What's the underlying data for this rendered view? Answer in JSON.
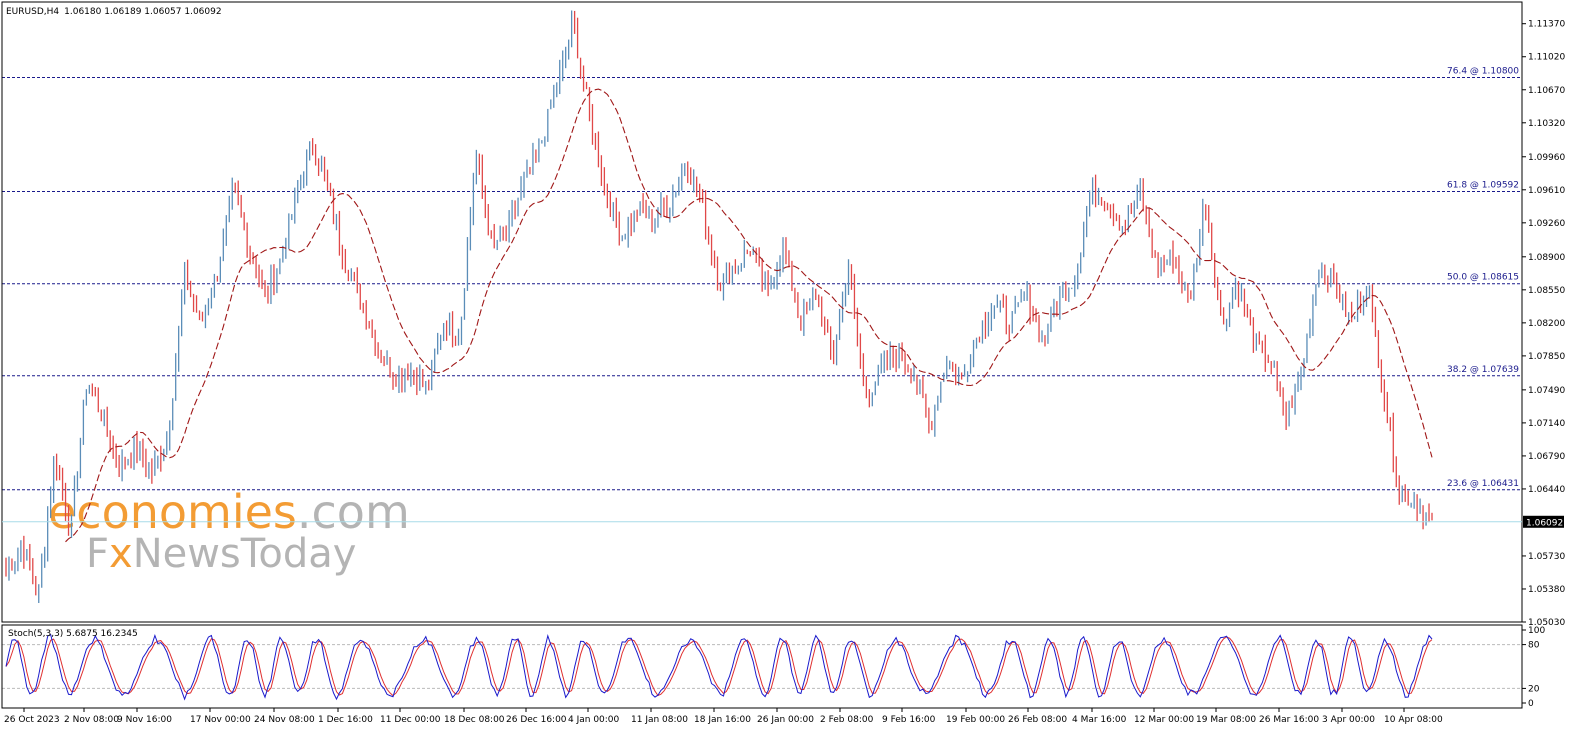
{
  "header": {
    "symbol": "EURUSD,H4",
    "ohlc": "1.06180 1.06189 1.06057 1.06092"
  },
  "watermark": {
    "line1_left": "economies",
    "line1_right": ".com",
    "line2_fx": "F",
    "line2_x": "x",
    "line2_rest": "NewsToday"
  },
  "colors": {
    "bull": "#5b8db8",
    "bear": "#e04848",
    "ma": "#a01818",
    "fib": "#1a1a8c",
    "current_price_line": "#a8dce8",
    "stoch_main": "#1a1acc",
    "stoch_signal": "#e03030",
    "watermark_orange": "#f39c34",
    "watermark_gray": "#b4b4b4"
  },
  "chart_data": {
    "type": "candlestick",
    "instrument": "EURUSD",
    "timeframe": "H4",
    "ylim": [
      1.0503,
      1.116
    ],
    "y_ticks": [
      "1.11370",
      "1.11020",
      "1.10670",
      "1.10320",
      "1.09960",
      "1.09610",
      "1.09260",
      "1.08900",
      "1.08550",
      "1.08200",
      "1.07850",
      "1.07490",
      "1.07140",
      "1.06790",
      "1.06440",
      "1.05730",
      "1.05380",
      "1.05030"
    ],
    "x_ticks": [
      "26 Oct 2023",
      "2 Nov 08:00",
      "9 Nov 16:00",
      "17 Nov 00:00",
      "24 Nov 08:00",
      "1 Dec 16:00",
      "11 Dec 00:00",
      "18 Dec 08:00",
      "26 Dec 16:00",
      "4 Jan 00:00",
      "11 Jan 08:00",
      "18 Jan 16:00",
      "26 Jan 00:00",
      "2 Feb 08:00",
      "9 Feb 16:00",
      "19 Feb 00:00",
      "26 Feb 08:00",
      "4 Mar 16:00",
      "12 Mar 00:00",
      "19 Mar 08:00",
      "26 Mar 16:00",
      "3 Apr 00:00",
      "10 Apr 08:00"
    ],
    "current_price": 1.06092,
    "current_price_label": "1.06092",
    "fib_levels": [
      {
        "label": "76.4 @ 1.10800",
        "price": 1.108
      },
      {
        "label": "61.8 @ 1.09592",
        "price": 1.09592
      },
      {
        "label": "50.0 @ 1.08615",
        "price": 1.08615
      },
      {
        "label": "38.2 @ 1.07639",
        "price": 1.07639
      },
      {
        "label": "23.6 @ 1.06431",
        "price": 1.06431
      }
    ],
    "price_path_closes": [
      1.0555,
      1.0585,
      1.053,
      1.068,
      1.06,
      1.076,
      1.072,
      1.0665,
      1.069,
      1.066,
      1.07,
      1.087,
      1.082,
      1.087,
      1.096,
      1.09,
      1.085,
      1.089,
      1.096,
      1.101,
      1.095,
      1.088,
      1.084,
      1.079,
      1.0765,
      1.077,
      1.075,
      1.082,
      1.081,
      1.1,
      1.09,
      1.092,
      1.097,
      1.101,
      1.107,
      1.1137,
      1.104,
      1.096,
      1.091,
      1.094,
      1.093,
      1.095,
      1.099,
      1.094,
      1.086,
      1.088,
      1.09,
      1.085,
      1.09,
      1.082,
      1.085,
      1.078,
      1.088,
      1.074,
      1.077,
      1.079,
      1.077,
      1.071,
      1.078,
      1.076,
      1.081,
      1.084,
      1.082,
      1.085,
      1.08,
      1.085,
      1.087,
      1.096,
      1.095,
      1.092,
      1.096,
      1.088,
      1.089,
      1.084,
      1.095,
      1.082,
      1.086,
      1.08,
      1.078,
      1.072,
      1.077,
      1.088,
      1.086,
      1.082,
      1.086,
      1.075,
      1.064,
      1.063,
      1.061
    ]
  },
  "indicator": {
    "label": "Stoch(5,3,3) 5.6875 16.2345",
    "y_ticks": [
      "100",
      "80",
      "20",
      "0"
    ],
    "levels": [
      80,
      20
    ]
  }
}
